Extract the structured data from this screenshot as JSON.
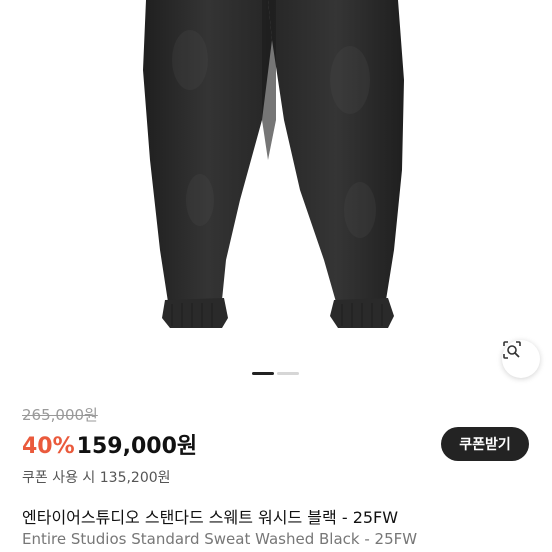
{
  "product": {
    "original_price": "265,000원",
    "discount_percent": "40%",
    "sale_price": "159,000원",
    "coupon_button_label": "쿠폰받기",
    "coupon_price_text": "쿠폰 사용 시 135,200원",
    "title_korean": "엔타이어스튜디오 스탠다드 스웨트 워시드 블랙 - 25FW",
    "title_english": "Entire Studios Standard Sweat Washed Black - 25FW"
  },
  "gallery": {
    "total_images": 2,
    "current_index": 1
  },
  "icons": {
    "lens": "lens-search-icon"
  },
  "colors": {
    "discount": "#ea5a3c",
    "button_bg": "#232323",
    "pants": "#2b2b2b"
  }
}
